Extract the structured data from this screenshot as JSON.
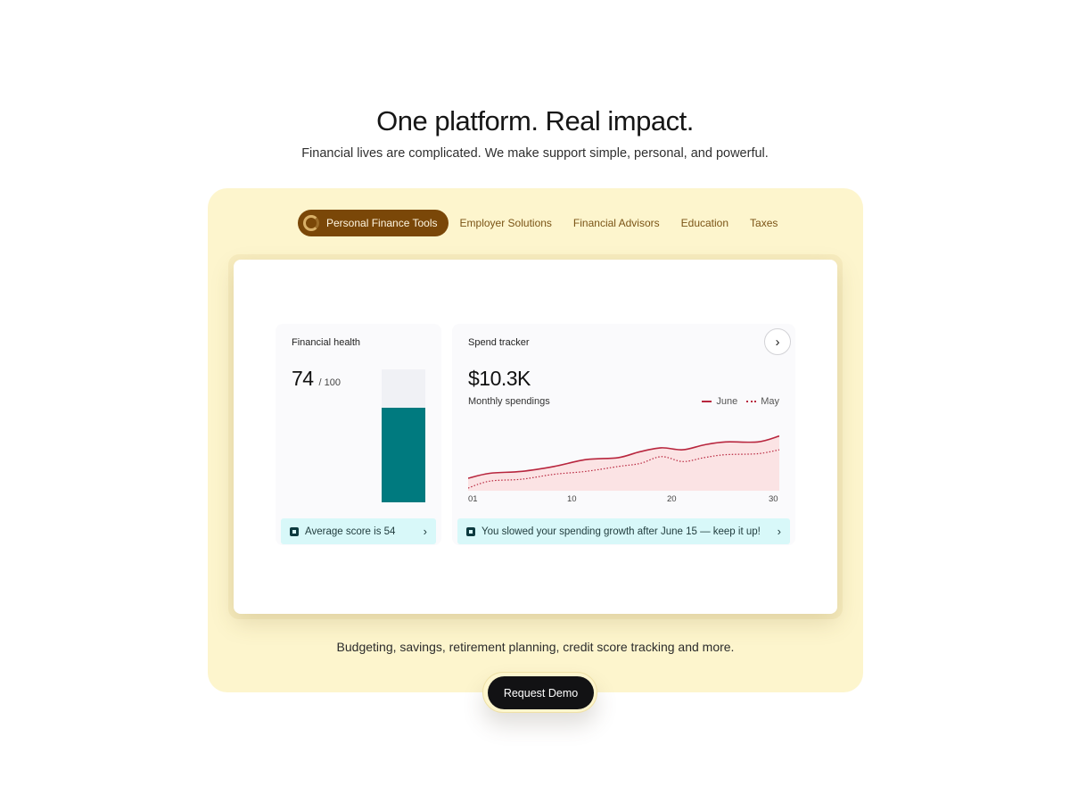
{
  "hero": {
    "title": "One platform. Real impact.",
    "subtitle": "Financial lives are complicated. We make support simple, personal, and powerful."
  },
  "tabs": [
    {
      "label": "Personal Finance Tools",
      "active": true
    },
    {
      "label": "Employer Solutions",
      "active": false
    },
    {
      "label": "Financial Advisors",
      "active": false
    },
    {
      "label": "Education",
      "active": false
    },
    {
      "label": "Taxes",
      "active": false
    }
  ],
  "financial_health": {
    "title": "Financial health",
    "score": "74",
    "max": "/ 100",
    "score_fraction": 0.71,
    "tip": "Average score is 54"
  },
  "spend_tracker": {
    "title": "Spend tracker",
    "amount": "$10.3K",
    "subtitle": "Monthly spendings",
    "legend": [
      "June",
      "May"
    ],
    "tip": "You slowed your spending growth after June 15 — keep it up!"
  },
  "chart_data": {
    "type": "line",
    "x_ticks": [
      "01",
      "10",
      "20",
      "30"
    ],
    "x": [
      1,
      3,
      6,
      9,
      12,
      15,
      17,
      19,
      21,
      23,
      25,
      28,
      30
    ],
    "series": [
      {
        "name": "June",
        "style": "solid",
        "values": [
          10,
          15,
          17,
          22,
          29,
          31,
          37,
          41,
          39,
          44,
          47,
          47,
          53
        ]
      },
      {
        "name": "May",
        "style": "dotted",
        "values": [
          0,
          7,
          9,
          14,
          17,
          22,
          25,
          32,
          27,
          31,
          34,
          35,
          39
        ]
      }
    ],
    "ylim": [
      0,
      60
    ],
    "colors": {
      "line": "#b8263e",
      "fill": "#fbe3e4"
    }
  },
  "description": "Budgeting, savings, retirement planning, credit score tracking and more.",
  "cta": {
    "label": "Request Demo"
  },
  "colors": {
    "panel": "#fdf5cd",
    "tab_active": "#7a4708",
    "bar": "#007a7f",
    "tip_bg": "#d8f8f9"
  }
}
